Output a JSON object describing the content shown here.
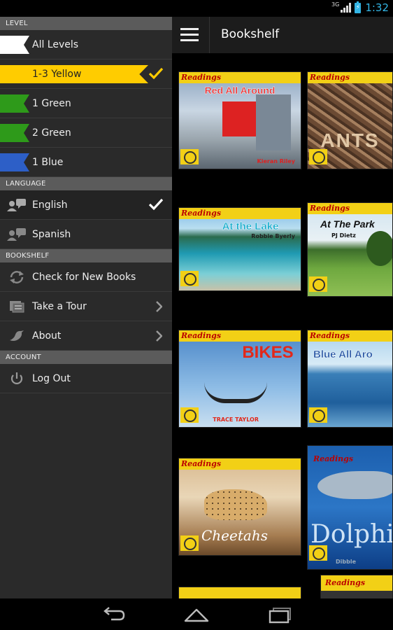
{
  "status": {
    "network": "3G",
    "battery_label": "⚡",
    "time": "1:32"
  },
  "drawer": {
    "level_header": "LEVEL",
    "levels": [
      {
        "label": "All Levels",
        "color": "#ffffff"
      },
      {
        "label": "1-3 Yellow",
        "color": "#ffcc00",
        "selected": true
      },
      {
        "label": "1 Green",
        "color": "#2e9a1a"
      },
      {
        "label": "2 Green",
        "color": "#2e9a1a"
      },
      {
        "label": "1 Blue",
        "color": "#2d5fc7"
      }
    ],
    "language_header": "LANGUAGE",
    "languages": [
      {
        "label": "English",
        "selected": true
      },
      {
        "label": "Spanish"
      }
    ],
    "bookshelf_header": "BOOKSHELF",
    "bookshelf_items": [
      {
        "label": "Check for New Books",
        "icon": "refresh-icon"
      },
      {
        "label": "Take a Tour",
        "icon": "tour-icon"
      },
      {
        "label": "About",
        "icon": "bird-icon"
      }
    ],
    "account_header": "ACCOUNT",
    "account_items": [
      {
        "label": "Log Out",
        "icon": "power-icon"
      }
    ]
  },
  "actionbar": {
    "title": "Bookshelf"
  },
  "books": [
    {
      "series": "Readings",
      "title": "Red All Around",
      "author": "Kieran Riley"
    },
    {
      "series": "Readings",
      "title": "ANTS",
      "author": ""
    },
    {
      "series": "Readings",
      "title": "At the Lake",
      "author": "Robbie Byerly"
    },
    {
      "series": "Readings",
      "title": "At The Park",
      "author": "PJ Dietz"
    },
    {
      "series": "Readings",
      "title": "BIKES",
      "author": "TRACE TAYLOR"
    },
    {
      "series": "Readings",
      "title": "Blue All Aro",
      "author": ""
    },
    {
      "series": "Readings",
      "title": "Cheetahs",
      "author": ""
    },
    {
      "series": "Readings",
      "title": "Dolphi",
      "author": "Dibble"
    },
    {
      "series": "Readings",
      "title": "",
      "author": ""
    }
  ]
}
